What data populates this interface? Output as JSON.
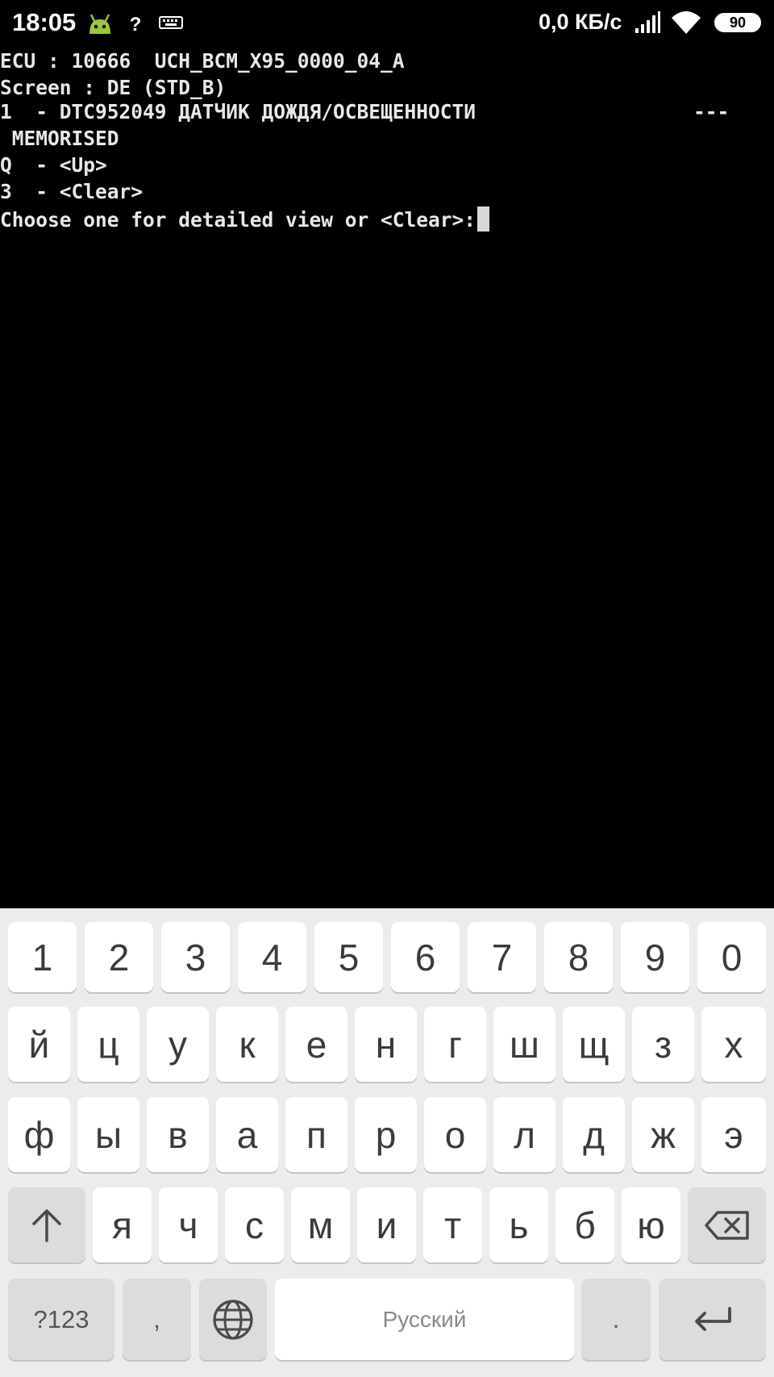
{
  "status_bar": {
    "time": "18:05",
    "net_speed": "0,0 КБ/с",
    "battery": "90",
    "icons": [
      "android-notification-icon",
      "unknown-network-icon",
      "keyboard-icon",
      "signal-icon",
      "wifi-icon",
      "battery-icon"
    ]
  },
  "terminal": {
    "lines": [
      "ECU : 10666  UCH_BCM_X95_0000_04_A",
      "Screen : DE (STD_B)",
      "1  - DTC952049 ДАТЧИК ДОЖДЯ/ОСВЕЩЕННОСТИ",
      " MEMORISED",
      "Q  - <Up>",
      "3  - <Clear>",
      "Choose one for detailed view or <Clear>:"
    ],
    "separator": "---"
  },
  "keyboard": {
    "row_numbers": [
      "1",
      "2",
      "3",
      "4",
      "5",
      "6",
      "7",
      "8",
      "9",
      "0"
    ],
    "row1": [
      "й",
      "ц",
      "у",
      "к",
      "е",
      "н",
      "г",
      "ш",
      "щ",
      "з",
      "х"
    ],
    "row2": [
      "ф",
      "ы",
      "в",
      "а",
      "п",
      "р",
      "о",
      "л",
      "д",
      "ж",
      "э"
    ],
    "row3": [
      "я",
      "ч",
      "с",
      "м",
      "и",
      "т",
      "ь",
      "б",
      "ю"
    ],
    "symbols_label": "?123",
    "comma": ",",
    "space_label": "Русский",
    "period": ".",
    "shift_icon": "shift-arrow-icon",
    "backspace_icon": "backspace-icon",
    "globe_icon": "globe-icon",
    "enter_icon": "enter-icon"
  },
  "colors": {
    "terminal_bg": "#000000",
    "terminal_text": "#e8e8e8",
    "keyboard_bg": "#ececec",
    "key_bg": "#ffffff",
    "func_key_bg": "#dcdcdc"
  }
}
